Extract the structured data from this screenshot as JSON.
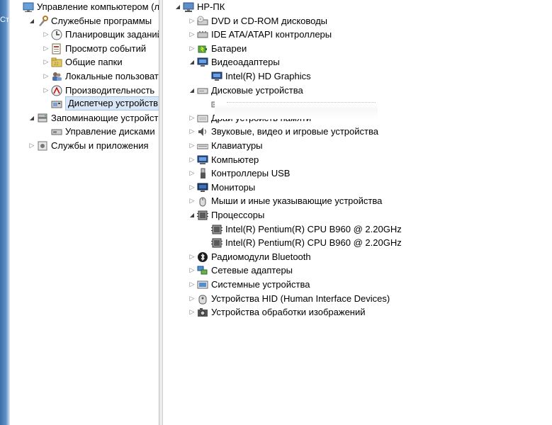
{
  "left_tree": [
    {
      "label": "Управление компьютером (л",
      "indent": 0,
      "expander": "",
      "icon": "computer-management-icon"
    },
    {
      "label": "Служебные программы",
      "indent": 1,
      "expander": "open",
      "icon": "tools-icon"
    },
    {
      "label": "Планировщик заданий",
      "indent": 2,
      "expander": "closed",
      "icon": "clock-icon"
    },
    {
      "label": "Просмотр событий",
      "indent": 2,
      "expander": "closed",
      "icon": "event-viewer-icon"
    },
    {
      "label": "Общие папки",
      "indent": 2,
      "expander": "closed",
      "icon": "shared-folder-icon"
    },
    {
      "label": "Локальные пользовате",
      "indent": 2,
      "expander": "closed",
      "icon": "users-icon"
    },
    {
      "label": "Производительность",
      "indent": 2,
      "expander": "closed",
      "icon": "performance-icon"
    },
    {
      "label": "Диспетчер устройств",
      "indent": 2,
      "expander": "",
      "icon": "device-manager-icon",
      "selected": true
    },
    {
      "label": "Запоминающие устройст",
      "indent": 1,
      "expander": "open",
      "icon": "storage-icon"
    },
    {
      "label": "Управление дисками",
      "indent": 2,
      "expander": "",
      "icon": "disk-management-icon"
    },
    {
      "label": "Службы и приложения",
      "indent": 1,
      "expander": "closed",
      "icon": "services-icon"
    }
  ],
  "right_tree": [
    {
      "label": "HP-ПК",
      "indent": 0,
      "expander": "open",
      "icon": "pc-icon"
    },
    {
      "label": "DVD и CD-ROM дисководы",
      "indent": 1,
      "expander": "closed",
      "icon": "dvd-icon"
    },
    {
      "label": "IDE ATA/ATAPI контроллеры",
      "indent": 1,
      "expander": "closed",
      "icon": "ide-controller-icon"
    },
    {
      "label": "Батареи",
      "indent": 1,
      "expander": "closed",
      "icon": "battery-icon"
    },
    {
      "label": "Видеоадаптеры",
      "indent": 1,
      "expander": "open",
      "icon": "display-adapter-icon"
    },
    {
      "label": "Intel(R) HD Graphics",
      "indent": 2,
      "expander": "",
      "icon": "display-adapter-icon"
    },
    {
      "label": "Дисковые устройства",
      "indent": 1,
      "expander": "open",
      "icon": "disk-drive-icon"
    },
    {
      "label": "",
      "indent": 2,
      "expander": "",
      "icon": "disk-drive-icon"
    },
    {
      "label": "Драй           устройств памяти",
      "indent": 1,
      "expander": "closed",
      "icon": "memory-driver-icon"
    },
    {
      "label": "Звуковые, видео и игровые устройства",
      "indent": 1,
      "expander": "closed",
      "icon": "sound-icon"
    },
    {
      "label": "Клавиатуры",
      "indent": 1,
      "expander": "closed",
      "icon": "keyboard-icon"
    },
    {
      "label": "Компьютер",
      "indent": 1,
      "expander": "closed",
      "icon": "computer-icon"
    },
    {
      "label": "Контроллеры USB",
      "indent": 1,
      "expander": "closed",
      "icon": "usb-icon"
    },
    {
      "label": "Мониторы",
      "indent": 1,
      "expander": "closed",
      "icon": "monitor-icon"
    },
    {
      "label": "Мыши и иные указывающие устройства",
      "indent": 1,
      "expander": "closed",
      "icon": "mouse-icon"
    },
    {
      "label": "Процессоры",
      "indent": 1,
      "expander": "open",
      "icon": "processor-icon"
    },
    {
      "label": "Intel(R) Pentium(R) CPU B960 @ 2.20GHz",
      "indent": 2,
      "expander": "",
      "icon": "processor-icon"
    },
    {
      "label": "Intel(R) Pentium(R) CPU B960 @ 2.20GHz",
      "indent": 2,
      "expander": "",
      "icon": "processor-icon"
    },
    {
      "label": "Радиомодули Bluetooth",
      "indent": 1,
      "expander": "closed",
      "icon": "bluetooth-icon"
    },
    {
      "label": "Сетевые адаптеры",
      "indent": 1,
      "expander": "closed",
      "icon": "network-adapter-icon"
    },
    {
      "label": "Системные устройства",
      "indent": 1,
      "expander": "closed",
      "icon": "system-devices-icon"
    },
    {
      "label": "Устройства HID (Human Interface Devices)",
      "indent": 1,
      "expander": "closed",
      "icon": "hid-icon"
    },
    {
      "label": "Устройства обработки изображений",
      "indent": 1,
      "expander": "closed",
      "icon": "imaging-icon"
    }
  ],
  "left_edge_text": "Ст"
}
